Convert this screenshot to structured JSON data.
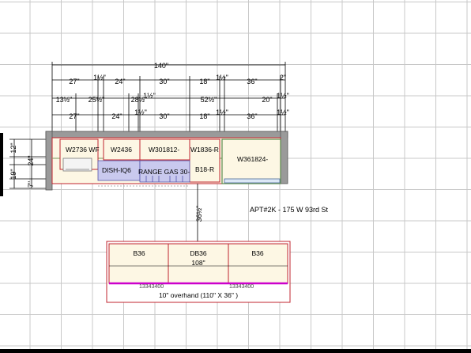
{
  "top_dims": {
    "total": "140\"",
    "row1": [
      "27\"",
      "1½\"",
      "24\"",
      "30\"",
      "18\"",
      "1½\"",
      "36\"",
      "2\""
    ],
    "row2": [
      "13½\"",
      "25½\"",
      "28½\"",
      "1½\"",
      "52½\"",
      "20\"",
      "1½\""
    ],
    "row3": [
      "27\"",
      "24\"",
      "1½\"",
      "30\"",
      "18\"",
      "1½\"",
      "36\"",
      "1½\""
    ]
  },
  "left_dims": [
    "12\"",
    "24\"",
    "19\"",
    "7\""
  ],
  "cabinets": {
    "w2736": "W2736 WF",
    "w2436": "W2436",
    "w301812": "W301812-",
    "w1836r": "W1836-R",
    "w361824": "W361824-",
    "dish": "DISH-IQ6",
    "range": "RANGE GAS 30-",
    "b18r": "B18-R"
  },
  "gap_dim": "36½\"",
  "apt_label": "APT#2K - 175 W 93rd St",
  "island": {
    "cab1": "B36",
    "cab2": "DB36",
    "cab3": "B36",
    "width": "108\"",
    "code1": "13343400",
    "code2": "13343400",
    "overhang": "10\" overhand (110\" X 36\" )"
  },
  "colors": {
    "cabinet_outline": "#c0242f",
    "cabinet_fill": "#fdf7e4",
    "appliance_fill": "#c9c9ee",
    "countertop_edge": "#cc00cc",
    "grid": "#c8c8c8"
  }
}
